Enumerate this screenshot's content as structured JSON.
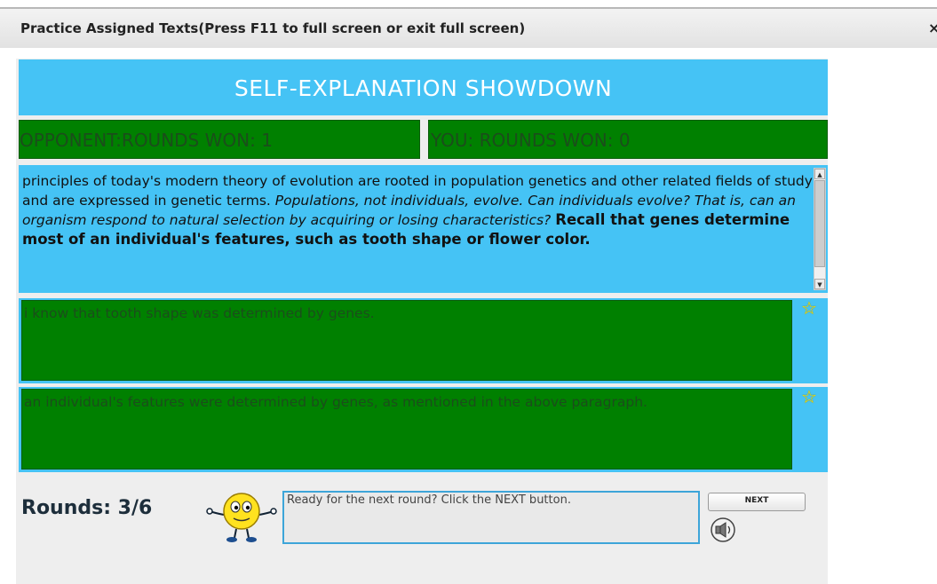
{
  "window": {
    "title": "Practice Assigned Texts(Press F11 to full screen or exit full screen)",
    "close_symbol": "×"
  },
  "game": {
    "header": "SELF-EXPLANATION SHOWDOWN",
    "opponent_score": "OPPONENT:ROUNDS WON: 1",
    "you_score": "YOU: ROUNDS WON: 0",
    "passage": {
      "normal": "principles of today's modern theory of evolution are rooted in population genetics and other related fields of study and are expressed in genetic terms.",
      "italic": "Populations, not individuals, evolve. Can individuals evolve? That is, can an organism respond to natural selection by acquiring or losing characteristics?",
      "bold": "Recall that genes determine most of an individual's features, such as tooth shape or flower color."
    },
    "answers": [
      {
        "text": "i   know that tooth shape was determined by genes.",
        "star_icon": "star-icon"
      },
      {
        "text": "an individual's features were determined by genes, as mentioned in the above paragraph.",
        "star_icon": "star-icon"
      }
    ],
    "rounds_label": "Rounds: 3/6",
    "message": "Ready for the next round? Click the NEXT button.",
    "next_label": "NEXT",
    "star_symbol": "☆"
  },
  "colors": {
    "header_blue": "#45c3f5",
    "score_green": "#008000",
    "star_yellow": "#ffe600"
  }
}
